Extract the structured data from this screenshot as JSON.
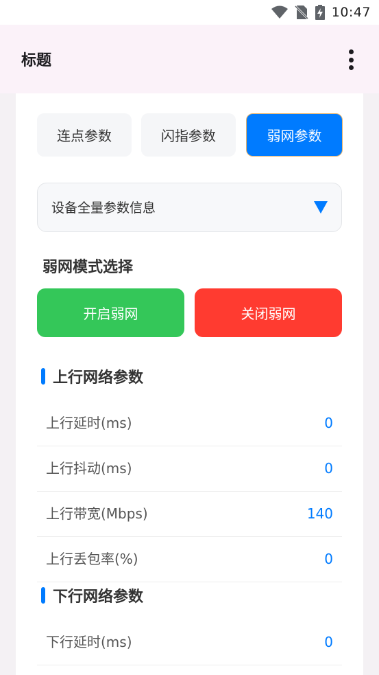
{
  "status": {
    "time": "10:47",
    "icons": [
      "wifi-icon",
      "no-sim-icon",
      "battery-charging-icon"
    ]
  },
  "app_bar": {
    "title": "标题",
    "menu_icon": "more-vert-icon"
  },
  "tabs": [
    {
      "label": "连点参数",
      "selected": false
    },
    {
      "label": "闪指参数",
      "selected": false
    },
    {
      "label": "弱网参数",
      "selected": true
    }
  ],
  "dropdown": {
    "value": "设备全量参数信息",
    "icon": "triangle-down-icon"
  },
  "mode": {
    "title": "弱网模式选择",
    "enable_label": "开启弱网",
    "disable_label": "关闭弱网"
  },
  "upstream": {
    "title": "上行网络参数",
    "rows": [
      {
        "label": "上行延时(ms)",
        "value": "0"
      },
      {
        "label": "上行抖动(ms)",
        "value": "0"
      },
      {
        "label": "上行带宽(Mbps)",
        "value": "140"
      },
      {
        "label": "上行丢包率(%)",
        "value": "0"
      }
    ]
  },
  "downstream": {
    "title": "下行网络参数",
    "rows": [
      {
        "label": "下行延时(ms)",
        "value": "0"
      }
    ]
  },
  "colors": {
    "accent": "#007bff",
    "enable": "#34c759",
    "disable": "#ff3b30",
    "app_bar_bg": "#fbf2f9"
  }
}
